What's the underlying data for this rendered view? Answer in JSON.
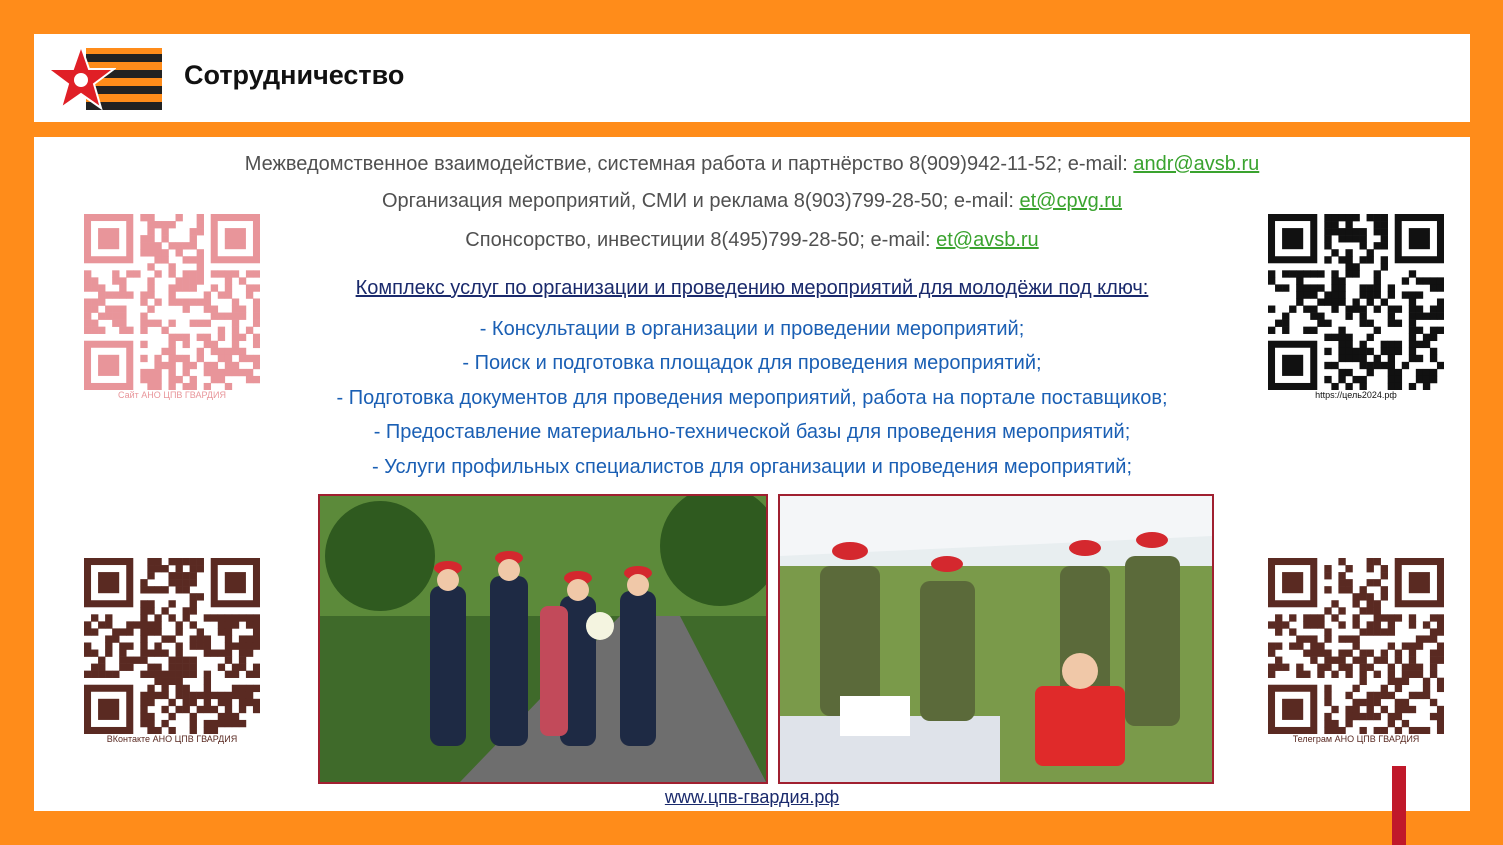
{
  "header": {
    "title": "Сотрудничество"
  },
  "contacts": [
    {
      "text": "Межведомственное взаимодействие, системная работа и партнёрство 8(909)942-11-52; e-mail: ",
      "email": "andr@avsb.ru"
    },
    {
      "text": "Организация мероприятий, СМИ и реклама 8(903)799-28-50; e-mail: ",
      "email": "et@cpvg.ru"
    },
    {
      "text": "Спонсорство, инвестиции 8(495)799-28-50; e-mail: ",
      "email": "et@avsb.ru"
    }
  ],
  "services": {
    "heading": "Комплекс услуг по организации и проведению мероприятий для молодёжи под ключ:",
    "items": [
      "- Консультации в организации и проведении мероприятий;",
      "- Поиск и подготовка площадок для проведения мероприятий;",
      "- Подготовка документов для проведения мероприятий, работа на портале поставщиков;",
      "- Предоставление материально-технической базы для проведения мероприятий;",
      "- Услуги профильных специалистов для организации и проведения мероприятий;"
    ]
  },
  "qr_codes": {
    "top_left": {
      "caption": "Сайт АНО ЦПВ ГВАРДИЯ",
      "color": "#e8959a"
    },
    "top_right": {
      "caption": "https://цель2024.рф",
      "color": "#111111"
    },
    "bottom_left": {
      "caption": "ВКонтакте АНО ЦПВ ГВАРДИЯ",
      "color": "#5a2a22"
    },
    "bottom_right": {
      "caption": "Телеграм АНО ЦПВ ГВАРДИЯ",
      "color": "#5a2a22"
    }
  },
  "footer": {
    "link": "www.цпв-гвардия.рф"
  },
  "colors": {
    "accent": "#ff8c1a",
    "email": "#3aa32f",
    "service_text": "#1a5fb4",
    "heading": "#1a2a6c"
  }
}
